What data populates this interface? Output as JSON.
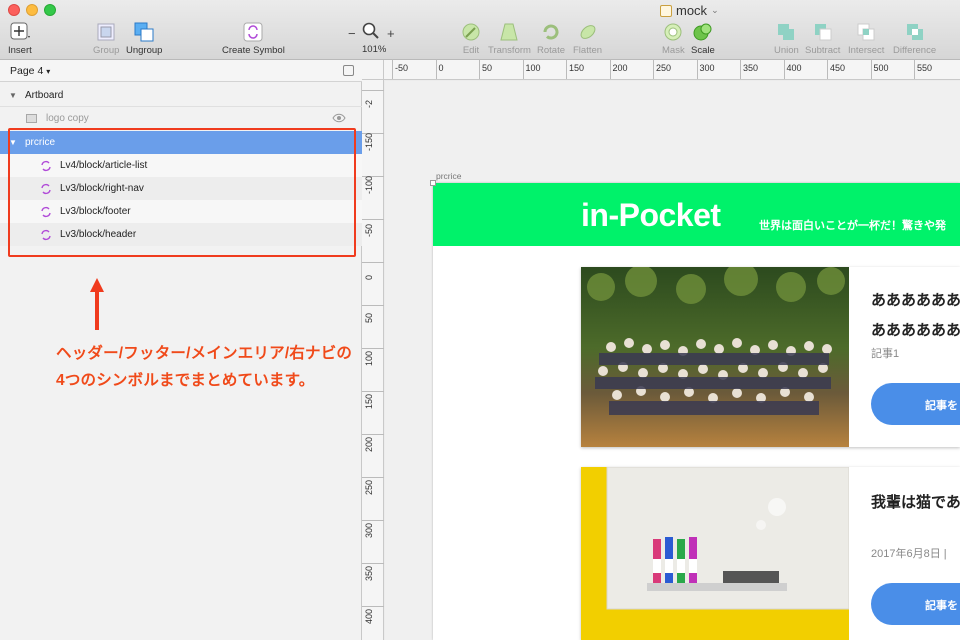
{
  "window": {
    "title": "mock"
  },
  "toolbar": {
    "insert": "Insert",
    "group": "Group",
    "ungroup": "Ungroup",
    "create_symbol": "Create Symbol",
    "zoom_minus": "−",
    "zoom_plus": "+",
    "zoom_level": "101%",
    "edit": "Edit",
    "transform": "Transform",
    "rotate": "Rotate",
    "flatten": "Flatten",
    "mask": "Mask",
    "scale": "Scale",
    "union": "Union",
    "subtract": "Subtract",
    "intersect": "Intersect",
    "difference": "Difference"
  },
  "sidebar": {
    "page": "Page 4",
    "layers": {
      "artboard": "Artboard",
      "logo_copy": "logo copy",
      "group": "prcrice",
      "symbols": [
        "Lv4/block/article-list",
        "Lv3/block/right-nav",
        "Lv3/block/footer",
        "Lv3/block/header"
      ]
    }
  },
  "annotation": {
    "line1": "ヘッダー/フッター/メインエリア/右ナビの",
    "line2": "4つのシンボルまでまとめています。"
  },
  "rulers": {
    "top": [
      "-50",
      "0",
      "50",
      "100",
      "150",
      "200",
      "250",
      "300",
      "350",
      "400",
      "450",
      "500",
      "550"
    ],
    "left": [
      "-2",
      "-150",
      "-100",
      "-50",
      "0",
      "50",
      "100",
      "150",
      "200",
      "250",
      "300",
      "350",
      "400"
    ]
  },
  "canvas": {
    "artboard_name": "prcrice",
    "site_title": "in-Pocket",
    "tagline": "世界は面白いことが一杯だ！驚きや発",
    "cards": [
      {
        "title_line1": "ああああああ",
        "title_line2": "ああああああ",
        "meta": "記事1",
        "button": "記事を"
      },
      {
        "title_line1": "我輩は猫であ",
        "meta": "2017年6月8日 |",
        "button": "記事を"
      }
    ]
  },
  "colors": {
    "accent_green": "#00f26a",
    "selection_blue": "#6a9eea",
    "annotation_red": "#f03b1e",
    "button_blue": "#4a8ee8"
  }
}
